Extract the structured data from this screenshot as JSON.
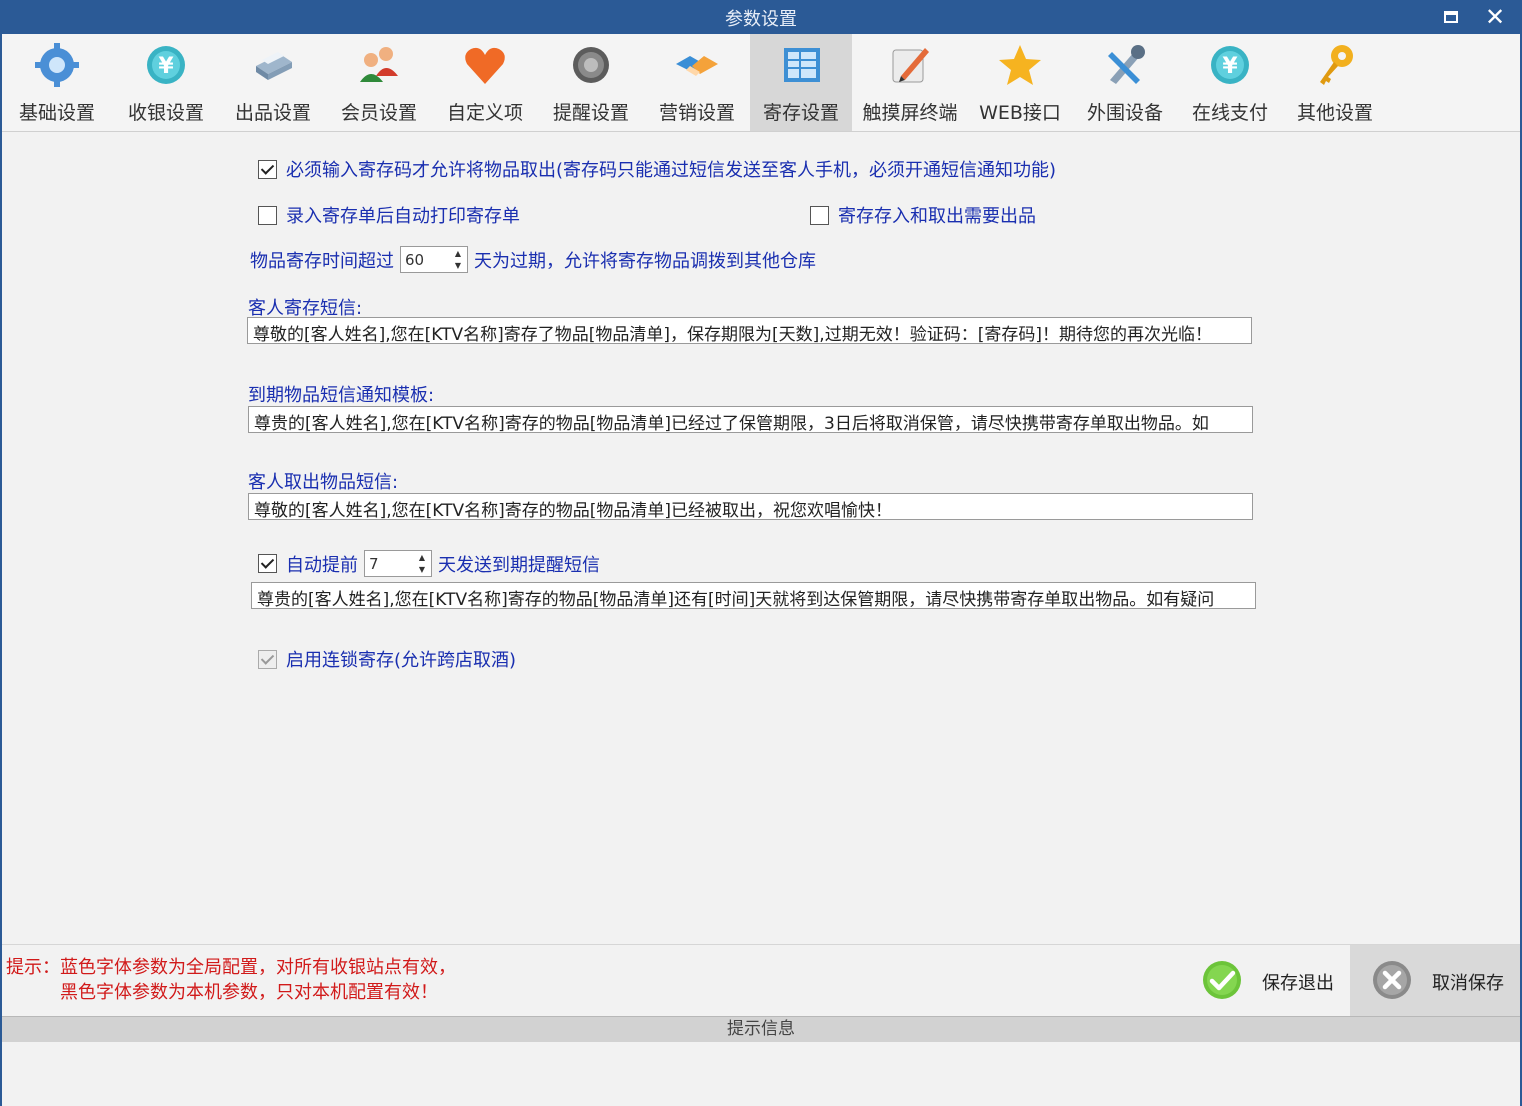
{
  "window": {
    "title": "参数设置",
    "close_glyph": "✕"
  },
  "toolbar": {
    "items": [
      {
        "label": "基础设置",
        "icon": "gear-icon"
      },
      {
        "label": "收银设置",
        "icon": "yen-coin-icon"
      },
      {
        "label": "出品设置",
        "icon": "printer-icon"
      },
      {
        "label": "会员设置",
        "icon": "users-icon"
      },
      {
        "label": "自定义项",
        "icon": "heart-icon"
      },
      {
        "label": "提醒设置",
        "icon": "speaker-icon"
      },
      {
        "label": "营销设置",
        "icon": "handshake-icon"
      },
      {
        "label": "寄存设置",
        "icon": "storage-icon",
        "active": true
      },
      {
        "label": "触摸屏终端",
        "icon": "touch-pen-icon"
      },
      {
        "label": "WEB接口",
        "icon": "star-icon"
      },
      {
        "label": "外围设备",
        "icon": "tools-icon"
      },
      {
        "label": "在线支付",
        "icon": "yen-coin-icon"
      },
      {
        "label": "其他设置",
        "icon": "key-icon"
      }
    ]
  },
  "storage": {
    "require_code": {
      "checked": true,
      "label": "必须输入寄存码才允许将物品取出(寄存码只能通过短信发送至客人手机，必须开通短信通知功能)"
    },
    "auto_print": {
      "checked": false,
      "label": "录入寄存单后自动打印寄存单"
    },
    "need_output": {
      "checked": false,
      "label": "寄存存入和取出需要出品"
    },
    "expiry": {
      "prefix": "物品寄存时间超过",
      "value": "60",
      "suffix": "天为过期，允许将寄存物品调拨到其他仓库"
    },
    "sms_deposit": {
      "label": "客人寄存短信:",
      "value": "尊敬的[客人姓名],您在[KTV名称]寄存了物品[物品清单]，保存期限为[天数],过期无效！验证码：[寄存码]！期待您的再次光临！"
    },
    "sms_expired": {
      "label": "到期物品短信通知模板:",
      "value": "尊贵的[客人姓名],您在[KTV名称]寄存的物品[物品清单]已经过了保管期限，3日后将取消保管，请尽快携带寄存单取出物品。如"
    },
    "sms_takeout": {
      "label": "客人取出物品短信:",
      "value": "尊敬的[客人姓名],您在[KTV名称]寄存的物品[物品清单]已经被取出，祝您欢唱愉快！"
    },
    "auto_remind": {
      "checked": true,
      "prefix": "自动提前",
      "days": "7",
      "suffix": "天发送到期提醒短信",
      "value": "尊贵的[客人姓名],您在[KTV名称]寄存的物品[物品清单]还有[时间]天就将到达保管期限，请尽快携带寄存单取出物品。如有疑问"
    },
    "chain_storage": {
      "checked": true,
      "disabled": true,
      "label": "启用连锁寄存(允许跨店取酒)"
    }
  },
  "footer": {
    "hint_line1": "提示：蓝色字体参数为全局配置，对所有收银站点有效，",
    "hint_line2": "黑色字体参数为本机参数，只对本机配置有效！",
    "save_label": "保存退出",
    "cancel_label": "取消保存",
    "status_text": "提示信息"
  },
  "colors": {
    "titlebar": "#2b5a96",
    "global_param_text": "#1a2fb0",
    "hint_text": "#d11a1a",
    "save_green": "#6cc43a"
  }
}
